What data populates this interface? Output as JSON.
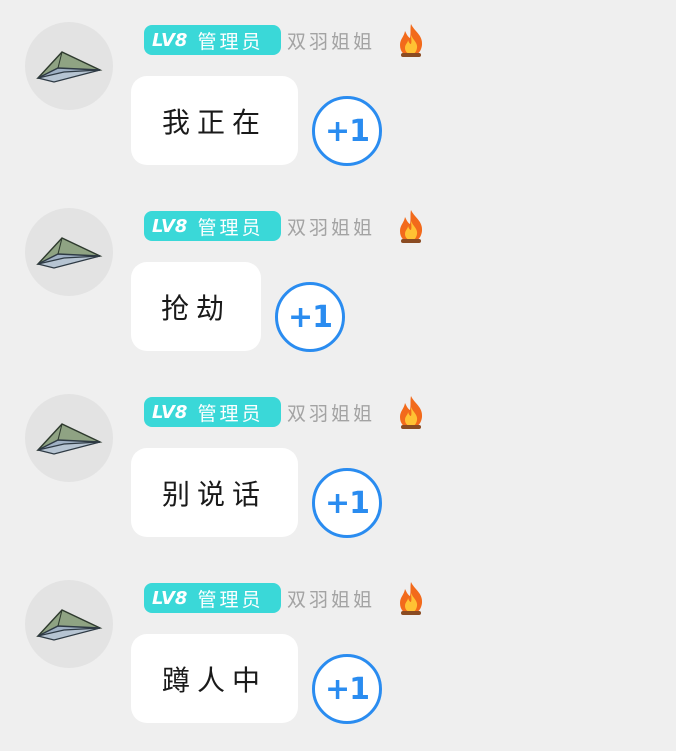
{
  "colors": {
    "background": "#efefef",
    "badge": "#3ad8d8",
    "nickname": "#a3a3a3",
    "bubble": "#ffffff",
    "plus_one": "#2a8cf0",
    "avatar_bg": "#e3e3e3"
  },
  "messages": [
    {
      "badge_level": "LV8",
      "badge_role": "管理员",
      "nickname": "双羽姐姐",
      "fire_icon": "fire-icon",
      "avatar_icon": "paper-plane-icon",
      "text": "我正在",
      "plus_one": "+1"
    },
    {
      "badge_level": "LV8",
      "badge_role": "管理员",
      "nickname": "双羽姐姐",
      "fire_icon": "fire-icon",
      "avatar_icon": "paper-plane-icon",
      "text": "抢劫",
      "plus_one": "+1"
    },
    {
      "badge_level": "LV8",
      "badge_role": "管理员",
      "nickname": "双羽姐姐",
      "fire_icon": "fire-icon",
      "avatar_icon": "paper-plane-icon",
      "text": "别说话",
      "plus_one": "+1"
    },
    {
      "badge_level": "LV8",
      "badge_role": "管理员",
      "nickname": "双羽姐姐",
      "fire_icon": "fire-icon",
      "avatar_icon": "paper-plane-icon",
      "text": "蹲人中",
      "plus_one": "+1"
    }
  ]
}
